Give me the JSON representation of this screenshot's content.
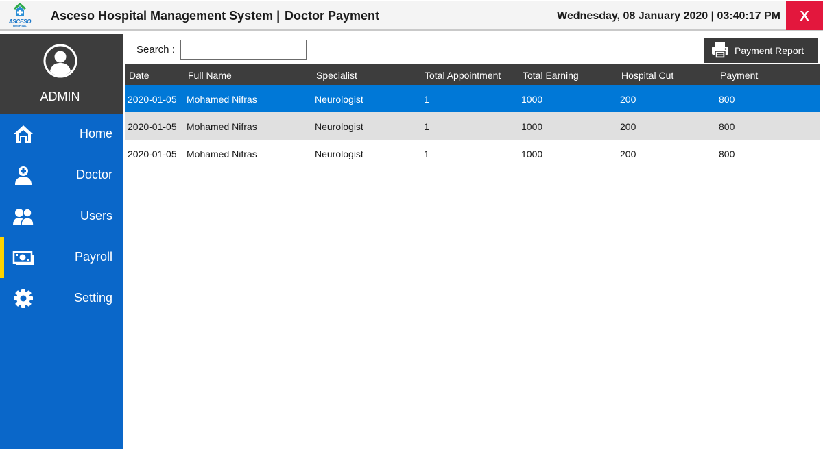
{
  "titlebar": {
    "logo_text": "ASCESO",
    "logo_subtext": "HOSPITAL",
    "app_title": "Asceso Hospital Management System |",
    "page_title": "Doctor Payment",
    "datetime": "Wednesday, 08 January 2020 | 03:40:17 PM",
    "close_label": "X"
  },
  "sidebar": {
    "user": "ADMIN",
    "items": [
      {
        "label": "Home",
        "icon": "home-icon",
        "active": false
      },
      {
        "label": "Doctor",
        "icon": "doctor-icon",
        "active": false
      },
      {
        "label": "Users",
        "icon": "users-icon",
        "active": false
      },
      {
        "label": "Payroll",
        "icon": "payroll-icon",
        "active": true
      },
      {
        "label": "Setting",
        "icon": "gear-icon",
        "active": false
      }
    ]
  },
  "search": {
    "label": "Search :",
    "value": ""
  },
  "report_button": {
    "label": "Payment Report",
    "icon": "printer-icon"
  },
  "table": {
    "columns": [
      "Date",
      "Full Name",
      "Specialist",
      "Total Appointment",
      "Total Earning",
      "Hospital Cut",
      "Payment"
    ],
    "rows": [
      [
        "2020-01-05",
        "Mohamed Nifras",
        "Neurologist",
        "1",
        "1000",
        "200",
        "800"
      ],
      [
        "2020-01-05",
        "Mohamed Nifras",
        "Neurologist",
        "1",
        "1000",
        "200",
        "800"
      ],
      [
        "2020-01-05",
        "Mohamed Nifras",
        "Neurologist",
        "1",
        "1000",
        "200",
        "800"
      ]
    ]
  },
  "colors": {
    "sidebar": "#0a67c9",
    "profile_bg": "#3d3d3d",
    "active_marker": "#ffd400",
    "selected_row": "#0078d7",
    "alt_row": "#e0e0e0",
    "close_button": "#e3173d"
  }
}
